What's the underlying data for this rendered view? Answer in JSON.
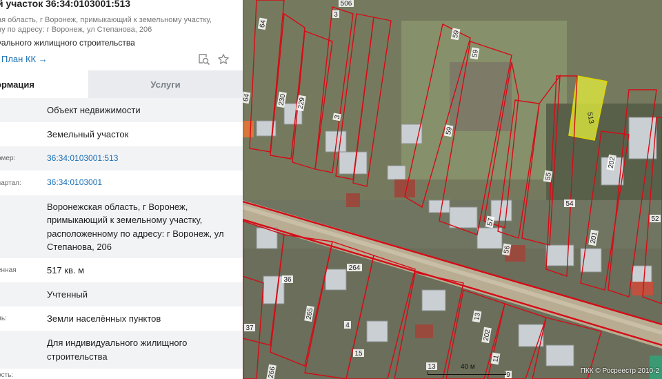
{
  "card": {
    "title": "й участок 36:34:0103001:513",
    "address_line1": "ая область, г Воронеж, примыкающий к земельному участку,",
    "address_line2": "ну по адресу: г Воронеж, ул Степанова, 206",
    "permitted_use": "уального жилищного строительства",
    "plan_link": "План КК →",
    "icons": {
      "search": "search-icon",
      "star": "star-icon"
    }
  },
  "tabs": [
    {
      "label": "ормация"
    },
    {
      "label": "Услуги"
    }
  ],
  "rows": [
    {
      "label": "",
      "value": "Объект недвижимости"
    },
    {
      "label": "",
      "value": "Земельный участок"
    },
    {
      "label": "омер:",
      "value": "36:34:0103001:513"
    },
    {
      "label": "вартал:",
      "value": "36:34:0103001"
    },
    {
      "label": "",
      "value": "Воронежская область, г Воронеж, примыкающий к земельному участку, расположенному по адресу: г Воронеж, ул Степанова, 206"
    },
    {
      "label": "енная",
      "value": "517 кв. м"
    },
    {
      "label": "",
      "value": "Учтенный"
    },
    {
      "label": "ль:",
      "value": "Земли населённых пунктов"
    },
    {
      "label": ":",
      "value": "Для индивидуального жилищного строительства"
    },
    {
      "label": "ость:",
      "value": ""
    }
  ],
  "map": {
    "selected_parcel_label": "513",
    "parcel_labels": [
      "506",
      "3",
      "64",
      "59",
      "59",
      "64",
      "230",
      "229",
      "3",
      "59",
      "202",
      "55",
      "54",
      "52",
      "57",
      "56",
      "201",
      "264",
      "36",
      "265",
      "4",
      "37",
      "13",
      "202",
      "11",
      "15",
      "13",
      "9",
      "266"
    ],
    "scale_label": "40 м",
    "copyright": "ПКК © Росреестр 2010-2",
    "colors": {
      "boundary": "#d50b16",
      "selected": "#e6f03c"
    }
  }
}
